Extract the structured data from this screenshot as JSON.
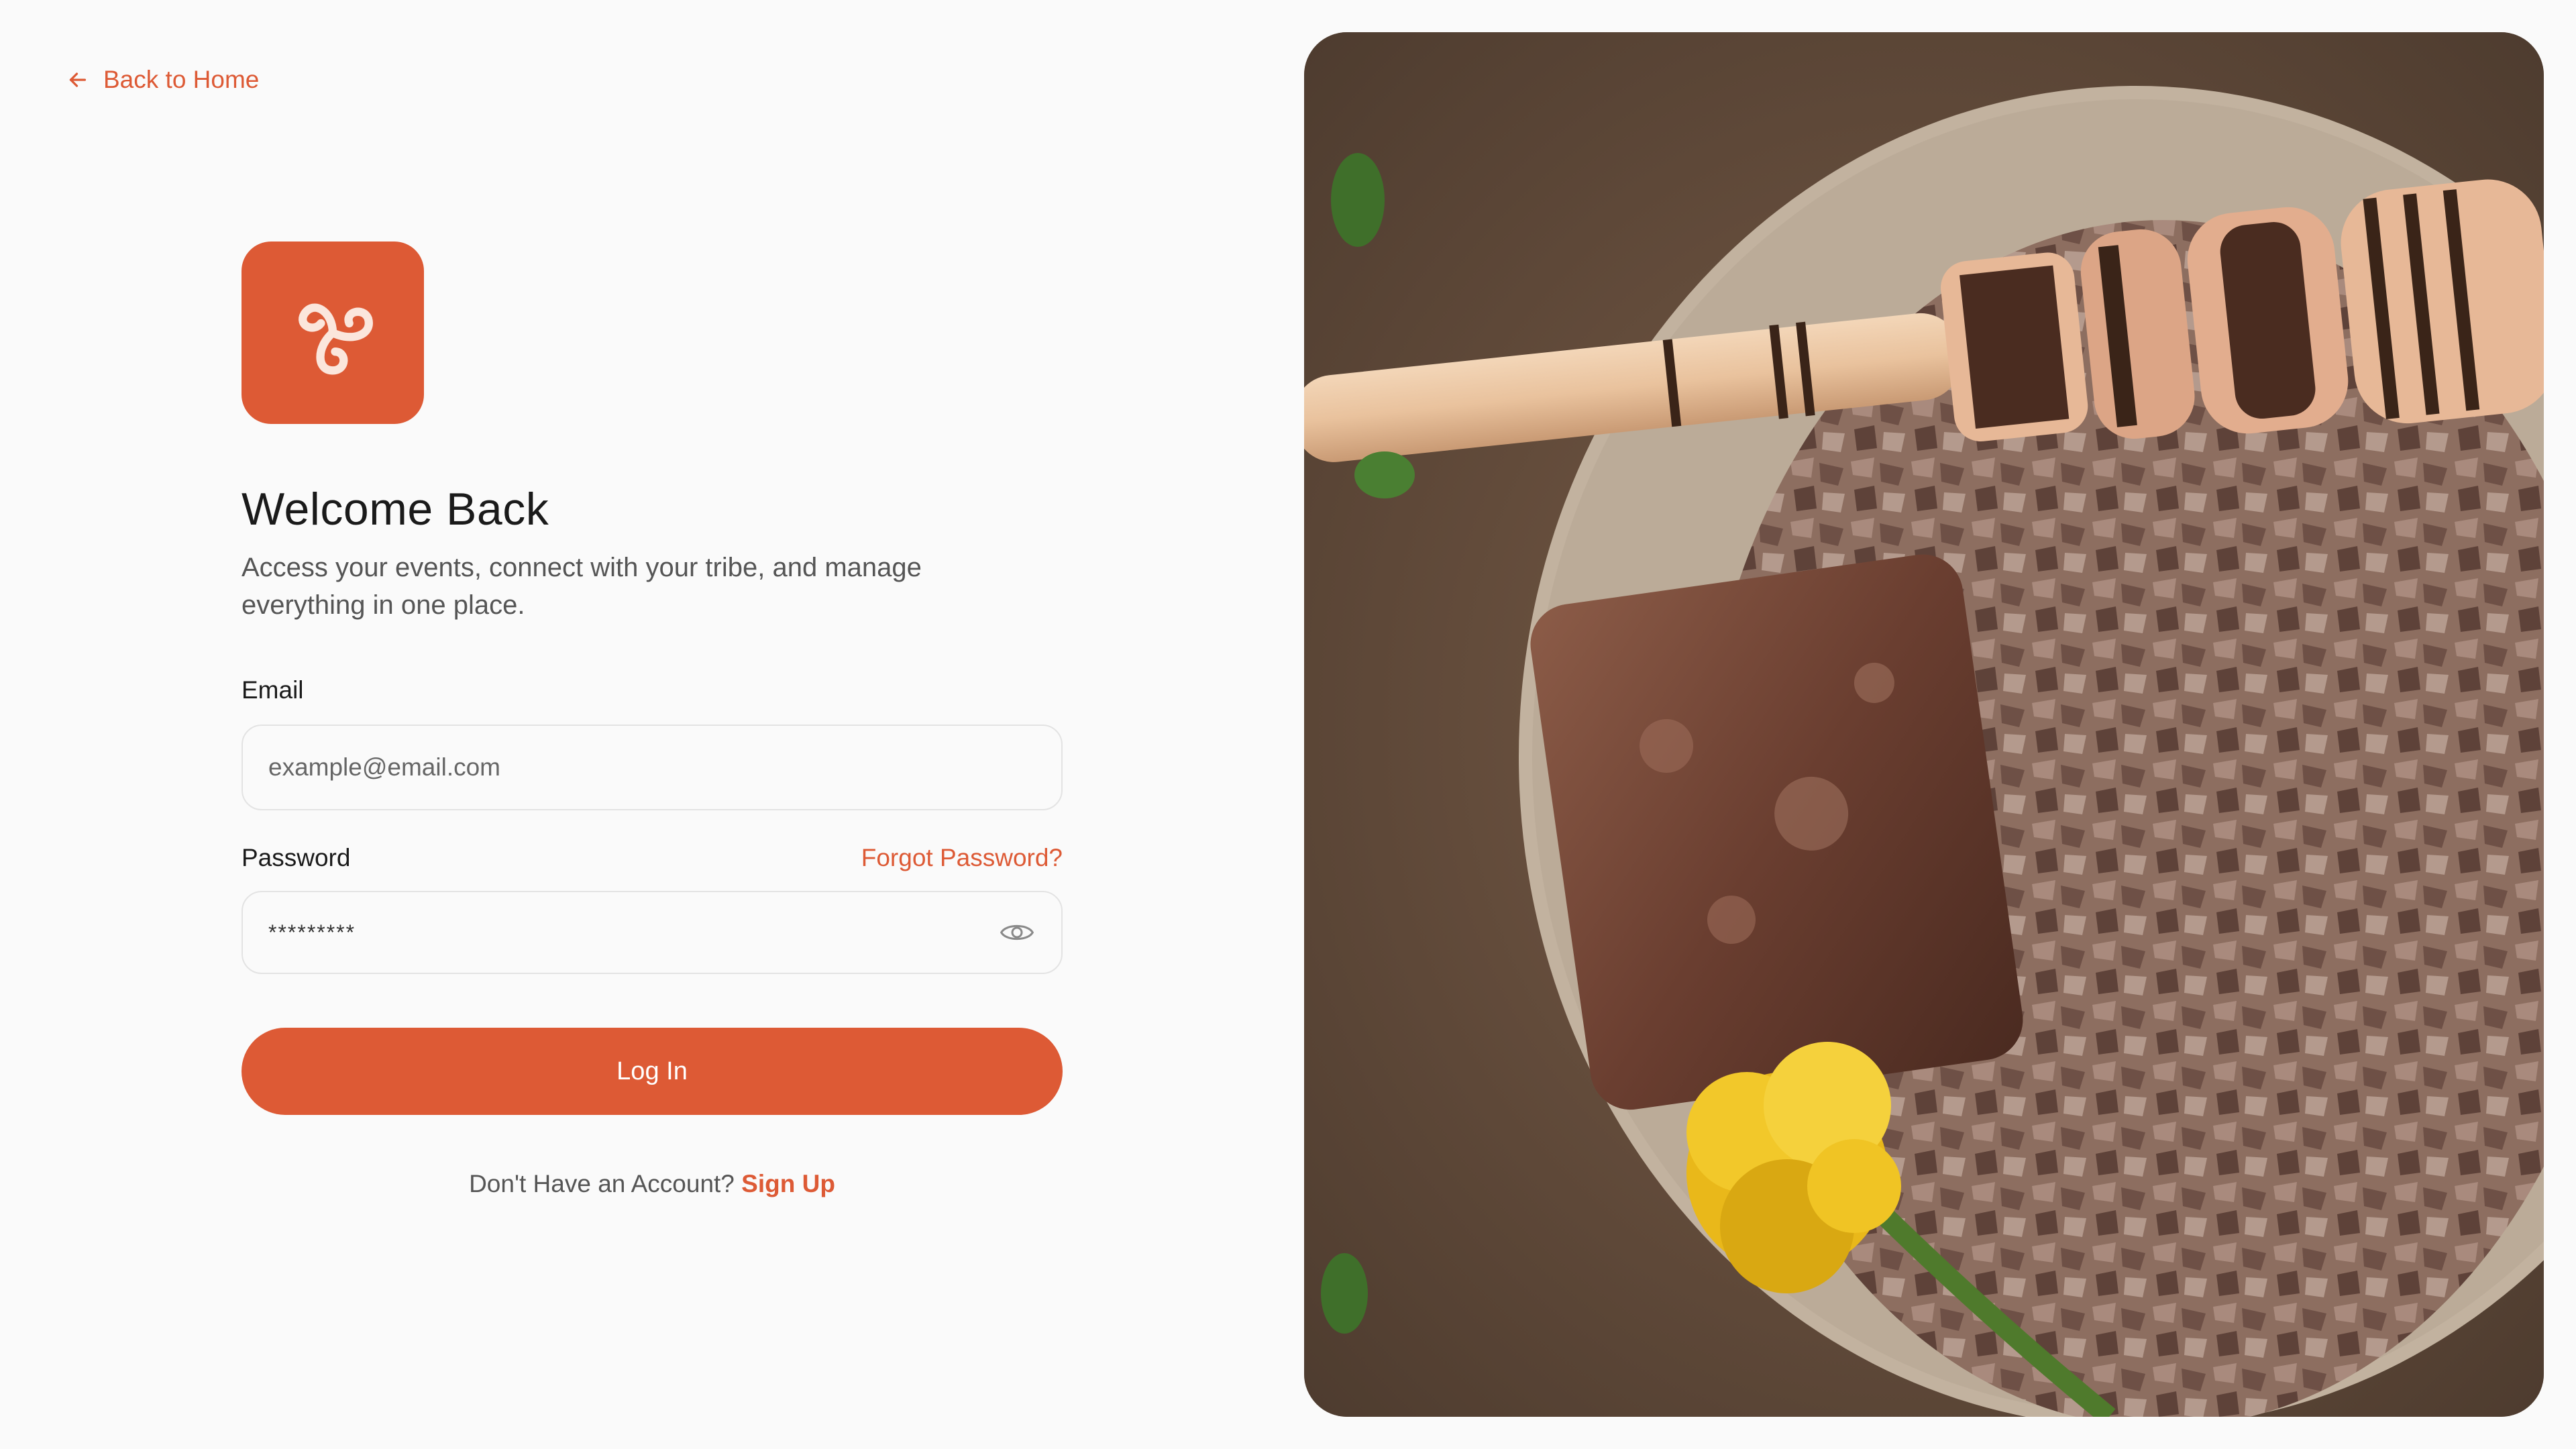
{
  "nav": {
    "back_label": "Back to Home"
  },
  "header": {
    "title": "Welcome Back",
    "subtitle": "Access your events, connect with your tribe, and manage everything in one place."
  },
  "form": {
    "email_label": "Email",
    "email_placeholder": "example@email.com",
    "email_value": "",
    "password_label": "Password",
    "forgot_label": "Forgot Password?",
    "password_masked": "*********",
    "login_label": "Log In"
  },
  "footer": {
    "prompt": "Don't Have an Account?",
    "signup_label": "Sign Up"
  },
  "icons": {
    "back": "arrow-left-icon",
    "logo": "triskele-icon",
    "password_toggle": "eye-icon"
  },
  "colors": {
    "accent": "#dd5a35",
    "background": "#fafafa",
    "border": "#e3e3e3"
  }
}
